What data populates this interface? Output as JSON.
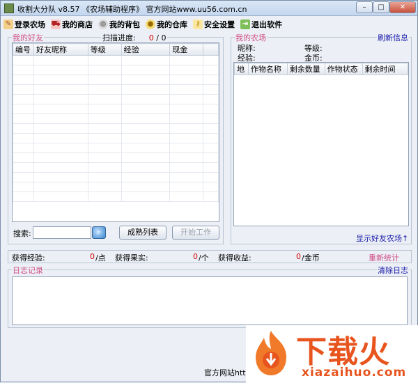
{
  "window": {
    "title": "收割大分队 v8.57 《农场辅助程序》 官方网站www.uu56.com.cn"
  },
  "toolbar": [
    {
      "label": "登录农场",
      "icon": "pencil-icon"
    },
    {
      "label": "我的商店",
      "icon": "cart-icon"
    },
    {
      "label": "我的背包",
      "icon": "globe-icon"
    },
    {
      "label": "我的仓库",
      "icon": "coins-icon"
    },
    {
      "label": "安全设置",
      "icon": "key-icon"
    },
    {
      "label": "退出软件",
      "icon": "exit-icon"
    }
  ],
  "friends": {
    "legend": "我的好友",
    "scan_label": "扫描进度:",
    "scan_done": "0",
    "scan_sep": "/",
    "scan_total": "0",
    "columns": [
      "编号",
      "好友昵称",
      "等级",
      "经验",
      "现金"
    ],
    "search_label": "搜索:",
    "search_value": "",
    "btn_mature": "成熟列表",
    "btn_start": "开始工作"
  },
  "farm": {
    "legend": "我的农场",
    "refresh": "刷新信息",
    "nickname_label": "昵称:",
    "level_label": "等级:",
    "exp_label": "经验:",
    "gold_label": "金币:",
    "columns": [
      "地",
      "作物名称",
      "剩余数量",
      "作物状态",
      "剩余时间"
    ],
    "show_friend_farm": "显示好友农场↑"
  },
  "stats": {
    "exp_label": "获得经验:",
    "exp_value": "0",
    "exp_unit": "/点",
    "fruit_label": "获得果实:",
    "fruit_value": "0",
    "fruit_unit": "/个",
    "income_label": "获得收益:",
    "income_value": "0",
    "income_unit": "/金币",
    "reset": "重新统计"
  },
  "log": {
    "legend": "日志记录",
    "clear": "清除日志"
  },
  "footer": {
    "text": "官方网站htt"
  },
  "watermark": {
    "brand": "下载火",
    "url": "xiazaihuo.com"
  }
}
